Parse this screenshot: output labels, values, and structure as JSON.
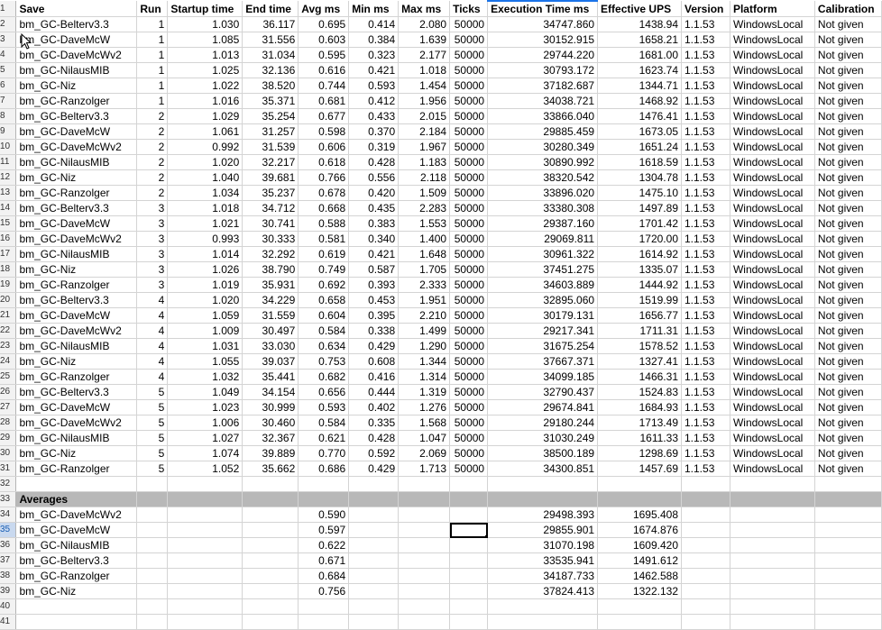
{
  "sheet": {
    "headers": [
      "Save",
      "Run",
      "Startup time",
      "End time",
      "Avg ms",
      "Min ms",
      "Max ms",
      "Ticks",
      "Execution Time ms",
      "Effective UPS",
      "Version",
      "Platform",
      "Calibration"
    ],
    "rows": [
      [
        "bm_GC-Belterv3.3",
        "1",
        "1.030",
        "36.117",
        "0.695",
        "0.414",
        "2.080",
        "50000",
        "34747.860",
        "1438.94",
        "1.1.53",
        "WindowsLocal",
        "Not given"
      ],
      [
        "bm_GC-DaveMcW",
        "1",
        "1.085",
        "31.556",
        "0.603",
        "0.384",
        "1.639",
        "50000",
        "30152.915",
        "1658.21",
        "1.1.53",
        "WindowsLocal",
        "Not given"
      ],
      [
        "bm_GC-DaveMcWv2",
        "1",
        "1.013",
        "31.034",
        "0.595",
        "0.323",
        "2.177",
        "50000",
        "29744.220",
        "1681.00",
        "1.1.53",
        "WindowsLocal",
        "Not given"
      ],
      [
        "bm_GC-NilausMIB",
        "1",
        "1.025",
        "32.136",
        "0.616",
        "0.421",
        "1.018",
        "50000",
        "30793.172",
        "1623.74",
        "1.1.53",
        "WindowsLocal",
        "Not given"
      ],
      [
        "bm_GC-Niz",
        "1",
        "1.022",
        "38.520",
        "0.744",
        "0.593",
        "1.454",
        "50000",
        "37182.687",
        "1344.71",
        "1.1.53",
        "WindowsLocal",
        "Not given"
      ],
      [
        "bm_GC-Ranzolger",
        "1",
        "1.016",
        "35.371",
        "0.681",
        "0.412",
        "1.956",
        "50000",
        "34038.721",
        "1468.92",
        "1.1.53",
        "WindowsLocal",
        "Not given"
      ],
      [
        "bm_GC-Belterv3.3",
        "2",
        "1.029",
        "35.254",
        "0.677",
        "0.433",
        "2.015",
        "50000",
        "33866.040",
        "1476.41",
        "1.1.53",
        "WindowsLocal",
        "Not given"
      ],
      [
        "bm_GC-DaveMcW",
        "2",
        "1.061",
        "31.257",
        "0.598",
        "0.370",
        "2.184",
        "50000",
        "29885.459",
        "1673.05",
        "1.1.53",
        "WindowsLocal",
        "Not given"
      ],
      [
        "bm_GC-DaveMcWv2",
        "2",
        "0.992",
        "31.539",
        "0.606",
        "0.319",
        "1.967",
        "50000",
        "30280.349",
        "1651.24",
        "1.1.53",
        "WindowsLocal",
        "Not given"
      ],
      [
        "bm_GC-NilausMIB",
        "2",
        "1.020",
        "32.217",
        "0.618",
        "0.428",
        "1.183",
        "50000",
        "30890.992",
        "1618.59",
        "1.1.53",
        "WindowsLocal",
        "Not given"
      ],
      [
        "bm_GC-Niz",
        "2",
        "1.040",
        "39.681",
        "0.766",
        "0.556",
        "2.118",
        "50000",
        "38320.542",
        "1304.78",
        "1.1.53",
        "WindowsLocal",
        "Not given"
      ],
      [
        "bm_GC-Ranzolger",
        "2",
        "1.034",
        "35.237",
        "0.678",
        "0.420",
        "1.509",
        "50000",
        "33896.020",
        "1475.10",
        "1.1.53",
        "WindowsLocal",
        "Not given"
      ],
      [
        "bm_GC-Belterv3.3",
        "3",
        "1.018",
        "34.712",
        "0.668",
        "0.435",
        "2.283",
        "50000",
        "33380.308",
        "1497.89",
        "1.1.53",
        "WindowsLocal",
        "Not given"
      ],
      [
        "bm_GC-DaveMcW",
        "3",
        "1.021",
        "30.741",
        "0.588",
        "0.383",
        "1.553",
        "50000",
        "29387.160",
        "1701.42",
        "1.1.53",
        "WindowsLocal",
        "Not given"
      ],
      [
        "bm_GC-DaveMcWv2",
        "3",
        "0.993",
        "30.333",
        "0.581",
        "0.340",
        "1.400",
        "50000",
        "29069.811",
        "1720.00",
        "1.1.53",
        "WindowsLocal",
        "Not given"
      ],
      [
        "bm_GC-NilausMIB",
        "3",
        "1.014",
        "32.292",
        "0.619",
        "0.421",
        "1.648",
        "50000",
        "30961.322",
        "1614.92",
        "1.1.53",
        "WindowsLocal",
        "Not given"
      ],
      [
        "bm_GC-Niz",
        "3",
        "1.026",
        "38.790",
        "0.749",
        "0.587",
        "1.705",
        "50000",
        "37451.275",
        "1335.07",
        "1.1.53",
        "WindowsLocal",
        "Not given"
      ],
      [
        "bm_GC-Ranzolger",
        "3",
        "1.019",
        "35.931",
        "0.692",
        "0.393",
        "2.333",
        "50000",
        "34603.889",
        "1444.92",
        "1.1.53",
        "WindowsLocal",
        "Not given"
      ],
      [
        "bm_GC-Belterv3.3",
        "4",
        "1.020",
        "34.229",
        "0.658",
        "0.453",
        "1.951",
        "50000",
        "32895.060",
        "1519.99",
        "1.1.53",
        "WindowsLocal",
        "Not given"
      ],
      [
        "bm_GC-DaveMcW",
        "4",
        "1.059",
        "31.559",
        "0.604",
        "0.395",
        "2.210",
        "50000",
        "30179.131",
        "1656.77",
        "1.1.53",
        "WindowsLocal",
        "Not given"
      ],
      [
        "bm_GC-DaveMcWv2",
        "4",
        "1.009",
        "30.497",
        "0.584",
        "0.338",
        "1.499",
        "50000",
        "29217.341",
        "1711.31",
        "1.1.53",
        "WindowsLocal",
        "Not given"
      ],
      [
        "bm_GC-NilausMIB",
        "4",
        "1.031",
        "33.030",
        "0.634",
        "0.429",
        "1.290",
        "50000",
        "31675.254",
        "1578.52",
        "1.1.53",
        "WindowsLocal",
        "Not given"
      ],
      [
        "bm_GC-Niz",
        "4",
        "1.055",
        "39.037",
        "0.753",
        "0.608",
        "1.344",
        "50000",
        "37667.371",
        "1327.41",
        "1.1.53",
        "WindowsLocal",
        "Not given"
      ],
      [
        "bm_GC-Ranzolger",
        "4",
        "1.032",
        "35.441",
        "0.682",
        "0.416",
        "1.314",
        "50000",
        "34099.185",
        "1466.31",
        "1.1.53",
        "WindowsLocal",
        "Not given"
      ],
      [
        "bm_GC-Belterv3.3",
        "5",
        "1.049",
        "34.154",
        "0.656",
        "0.444",
        "1.319",
        "50000",
        "32790.437",
        "1524.83",
        "1.1.53",
        "WindowsLocal",
        "Not given"
      ],
      [
        "bm_GC-DaveMcW",
        "5",
        "1.023",
        "30.999",
        "0.593",
        "0.402",
        "1.276",
        "50000",
        "29674.841",
        "1684.93",
        "1.1.53",
        "WindowsLocal",
        "Not given"
      ],
      [
        "bm_GC-DaveMcWv2",
        "5",
        "1.006",
        "30.460",
        "0.584",
        "0.335",
        "1.568",
        "50000",
        "29180.244",
        "1713.49",
        "1.1.53",
        "WindowsLocal",
        "Not given"
      ],
      [
        "bm_GC-NilausMIB",
        "5",
        "1.027",
        "32.367",
        "0.621",
        "0.428",
        "1.047",
        "50000",
        "31030.249",
        "1611.33",
        "1.1.53",
        "WindowsLocal",
        "Not given"
      ],
      [
        "bm_GC-Niz",
        "5",
        "1.074",
        "39.889",
        "0.770",
        "0.592",
        "2.069",
        "50000",
        "38500.189",
        "1298.69",
        "1.1.53",
        "WindowsLocal",
        "Not given"
      ],
      [
        "bm_GC-Ranzolger",
        "5",
        "1.052",
        "35.662",
        "0.686",
        "0.429",
        "1.713",
        "50000",
        "34300.851",
        "1457.69",
        "1.1.53",
        "WindowsLocal",
        "Not given"
      ]
    ],
    "averages_label": "Averages",
    "averages": [
      {
        "save": "bm_GC-DaveMcWv2",
        "avg": "0.590",
        "exec": "29498.393",
        "ups": "1695.408"
      },
      {
        "save": "bm_GC-DaveMcW",
        "avg": "0.597",
        "exec": "29855.901",
        "ups": "1674.876"
      },
      {
        "save": "bm_GC-NilausMIB",
        "avg": "0.622",
        "exec": "31070.198",
        "ups": "1609.420"
      },
      {
        "save": "bm_GC-Belterv3.3",
        "avg": "0.671",
        "exec": "33535.941",
        "ups": "1491.612"
      },
      {
        "save": "bm_GC-Ranzolger",
        "avg": "0.684",
        "exec": "34187.733",
        "ups": "1462.588"
      },
      {
        "save": "bm_GC-Niz",
        "avg": "0.756",
        "exec": "37824.413",
        "ups": "1322.132"
      }
    ],
    "row_numbers": [
      "1",
      "2",
      "3",
      "4",
      "5",
      "6",
      "7",
      "8",
      "9",
      "10",
      "11",
      "12",
      "13",
      "14",
      "15",
      "16",
      "17",
      "18",
      "19",
      "20",
      "21",
      "22",
      "23",
      "24",
      "25",
      "26",
      "27",
      "28",
      "29",
      "30",
      "31",
      "32",
      "33",
      "34",
      "35",
      "36",
      "37",
      "38",
      "39",
      "40",
      "41"
    ],
    "selected_row": "35"
  },
  "icons": {
    "cursor": "mouse-pointer-icon"
  }
}
